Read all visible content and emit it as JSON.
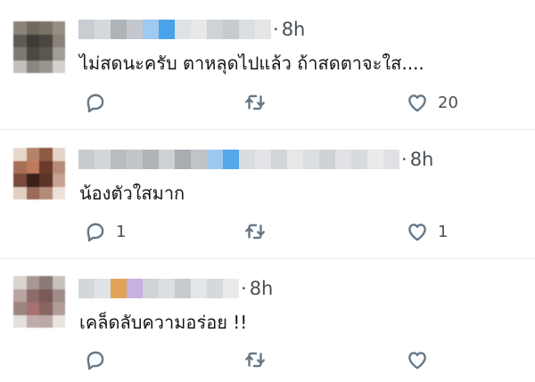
{
  "replies": [
    {
      "time": "8h",
      "text": "ไม่สดนะครับ ตาหลุดไปแล้ว ถ้าสดตาจะใส....",
      "reply_count": "",
      "retweet_count": "",
      "like_count": "20",
      "avatar_colors": [
        "#8b8478",
        "#6f6a5e",
        "#7a7468",
        "#948e84",
        "#5e5a52",
        "#3e3b36",
        "#4a4640",
        "#8a8278",
        "#7d7a74",
        "#4c4844",
        "#5a5650",
        "#a19c94",
        "#c4bfba",
        "#8a8680",
        "#9a9590",
        "#d4d0cc"
      ],
      "name_colors": [
        "#c9ccd0",
        "#d6d9dc",
        "#aeb3b8",
        "#c4c8cc",
        "#9ec9f0",
        "#4aa3ea",
        "#dfe2e5",
        "#e6e8ea",
        "#d0d3d6",
        "#c8cbce",
        "#dcdfe2",
        "#e4e6e8"
      ]
    },
    {
      "time": "8h",
      "text": "น้องตัวใสมาก",
      "reply_count": "1",
      "retweet_count": "",
      "like_count": "1",
      "avatar_colors": [
        "#e8d8cc",
        "#b5826a",
        "#8e5a44",
        "#e4d4c8",
        "#a86f58",
        "#c07a5a",
        "#6a3a2c",
        "#b88a78",
        "#7a4a3c",
        "#3a2018",
        "#5c3428",
        "#c8a090",
        "#e0d0c4",
        "#9a6a58",
        "#b48a7a",
        "#ece0d8"
      ],
      "name_colors": [
        "#c8cbcf",
        "#d4d7da",
        "#b8bcc0",
        "#c2c6ca",
        "#b0b4b8",
        "#cfd2d5",
        "#a8adb2",
        "#c0c4c8",
        "#9fc8ee",
        "#54a8ec",
        "#dadde0",
        "#e2e4e7",
        "#d2d5d8",
        "#e6e8ea",
        "#dcdfe2",
        "#cfd2d5",
        "#e0e2e5",
        "#d8dbde",
        "#e8eaec",
        "#dfe1e4"
      ]
    },
    {
      "time": "8h",
      "text": "เคล็ดลับความอร่อย !!",
      "reply_count": "",
      "retweet_count": "",
      "like_count": "",
      "avatar_colors": [
        "#d8d4d0",
        "#a89894",
        "#8a7a76",
        "#c8c0bc",
        "#b8a4a0",
        "#8c6c68",
        "#7a5a56",
        "#a08c88",
        "#9c8480",
        "#a87070",
        "#8a6460",
        "#b09c98",
        "#e4e0dc",
        "#c0aca8",
        "#bca8a4",
        "#e8e4e0"
      ],
      "name_colors": [
        "#d4d7da",
        "#e0e2e5",
        "#e2a25a",
        "#c8b0e0",
        "#d0d3d6",
        "#dcdfe2",
        "#c8cbce",
        "#e4e6e8",
        "#d6d9dc",
        "#e8eaec"
      ]
    }
  ]
}
